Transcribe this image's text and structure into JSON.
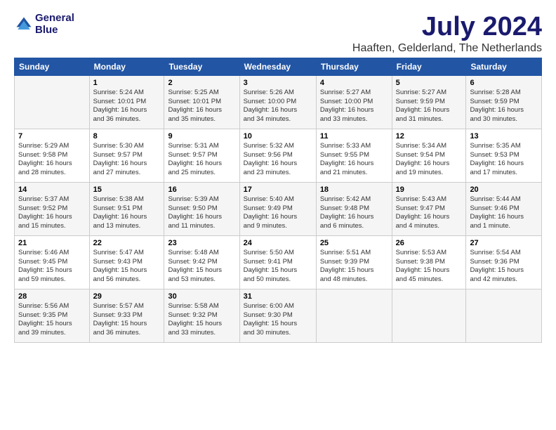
{
  "header": {
    "logo_line1": "General",
    "logo_line2": "Blue",
    "month_year": "July 2024",
    "location": "Haaften, Gelderland, The Netherlands"
  },
  "columns": [
    "Sunday",
    "Monday",
    "Tuesday",
    "Wednesday",
    "Thursday",
    "Friday",
    "Saturday"
  ],
  "weeks": [
    [
      {
        "day": "",
        "info": ""
      },
      {
        "day": "1",
        "info": "Sunrise: 5:24 AM\nSunset: 10:01 PM\nDaylight: 16 hours\nand 36 minutes."
      },
      {
        "day": "2",
        "info": "Sunrise: 5:25 AM\nSunset: 10:01 PM\nDaylight: 16 hours\nand 35 minutes."
      },
      {
        "day": "3",
        "info": "Sunrise: 5:26 AM\nSunset: 10:00 PM\nDaylight: 16 hours\nand 34 minutes."
      },
      {
        "day": "4",
        "info": "Sunrise: 5:27 AM\nSunset: 10:00 PM\nDaylight: 16 hours\nand 33 minutes."
      },
      {
        "day": "5",
        "info": "Sunrise: 5:27 AM\nSunset: 9:59 PM\nDaylight: 16 hours\nand 31 minutes."
      },
      {
        "day": "6",
        "info": "Sunrise: 5:28 AM\nSunset: 9:59 PM\nDaylight: 16 hours\nand 30 minutes."
      }
    ],
    [
      {
        "day": "7",
        "info": "Sunrise: 5:29 AM\nSunset: 9:58 PM\nDaylight: 16 hours\nand 28 minutes."
      },
      {
        "day": "8",
        "info": "Sunrise: 5:30 AM\nSunset: 9:57 PM\nDaylight: 16 hours\nand 27 minutes."
      },
      {
        "day": "9",
        "info": "Sunrise: 5:31 AM\nSunset: 9:57 PM\nDaylight: 16 hours\nand 25 minutes."
      },
      {
        "day": "10",
        "info": "Sunrise: 5:32 AM\nSunset: 9:56 PM\nDaylight: 16 hours\nand 23 minutes."
      },
      {
        "day": "11",
        "info": "Sunrise: 5:33 AM\nSunset: 9:55 PM\nDaylight: 16 hours\nand 21 minutes."
      },
      {
        "day": "12",
        "info": "Sunrise: 5:34 AM\nSunset: 9:54 PM\nDaylight: 16 hours\nand 19 minutes."
      },
      {
        "day": "13",
        "info": "Sunrise: 5:35 AM\nSunset: 9:53 PM\nDaylight: 16 hours\nand 17 minutes."
      }
    ],
    [
      {
        "day": "14",
        "info": "Sunrise: 5:37 AM\nSunset: 9:52 PM\nDaylight: 16 hours\nand 15 minutes."
      },
      {
        "day": "15",
        "info": "Sunrise: 5:38 AM\nSunset: 9:51 PM\nDaylight: 16 hours\nand 13 minutes."
      },
      {
        "day": "16",
        "info": "Sunrise: 5:39 AM\nSunset: 9:50 PM\nDaylight: 16 hours\nand 11 minutes."
      },
      {
        "day": "17",
        "info": "Sunrise: 5:40 AM\nSunset: 9:49 PM\nDaylight: 16 hours\nand 9 minutes."
      },
      {
        "day": "18",
        "info": "Sunrise: 5:42 AM\nSunset: 9:48 PM\nDaylight: 16 hours\nand 6 minutes."
      },
      {
        "day": "19",
        "info": "Sunrise: 5:43 AM\nSunset: 9:47 PM\nDaylight: 16 hours\nand 4 minutes."
      },
      {
        "day": "20",
        "info": "Sunrise: 5:44 AM\nSunset: 9:46 PM\nDaylight: 16 hours\nand 1 minute."
      }
    ],
    [
      {
        "day": "21",
        "info": "Sunrise: 5:46 AM\nSunset: 9:45 PM\nDaylight: 15 hours\nand 59 minutes."
      },
      {
        "day": "22",
        "info": "Sunrise: 5:47 AM\nSunset: 9:43 PM\nDaylight: 15 hours\nand 56 minutes."
      },
      {
        "day": "23",
        "info": "Sunrise: 5:48 AM\nSunset: 9:42 PM\nDaylight: 15 hours\nand 53 minutes."
      },
      {
        "day": "24",
        "info": "Sunrise: 5:50 AM\nSunset: 9:41 PM\nDaylight: 15 hours\nand 50 minutes."
      },
      {
        "day": "25",
        "info": "Sunrise: 5:51 AM\nSunset: 9:39 PM\nDaylight: 15 hours\nand 48 minutes."
      },
      {
        "day": "26",
        "info": "Sunrise: 5:53 AM\nSunset: 9:38 PM\nDaylight: 15 hours\nand 45 minutes."
      },
      {
        "day": "27",
        "info": "Sunrise: 5:54 AM\nSunset: 9:36 PM\nDaylight: 15 hours\nand 42 minutes."
      }
    ],
    [
      {
        "day": "28",
        "info": "Sunrise: 5:56 AM\nSunset: 9:35 PM\nDaylight: 15 hours\nand 39 minutes."
      },
      {
        "day": "29",
        "info": "Sunrise: 5:57 AM\nSunset: 9:33 PM\nDaylight: 15 hours\nand 36 minutes."
      },
      {
        "day": "30",
        "info": "Sunrise: 5:58 AM\nSunset: 9:32 PM\nDaylight: 15 hours\nand 33 minutes."
      },
      {
        "day": "31",
        "info": "Sunrise: 6:00 AM\nSunset: 9:30 PM\nDaylight: 15 hours\nand 30 minutes."
      },
      {
        "day": "",
        "info": ""
      },
      {
        "day": "",
        "info": ""
      },
      {
        "day": "",
        "info": ""
      }
    ]
  ]
}
